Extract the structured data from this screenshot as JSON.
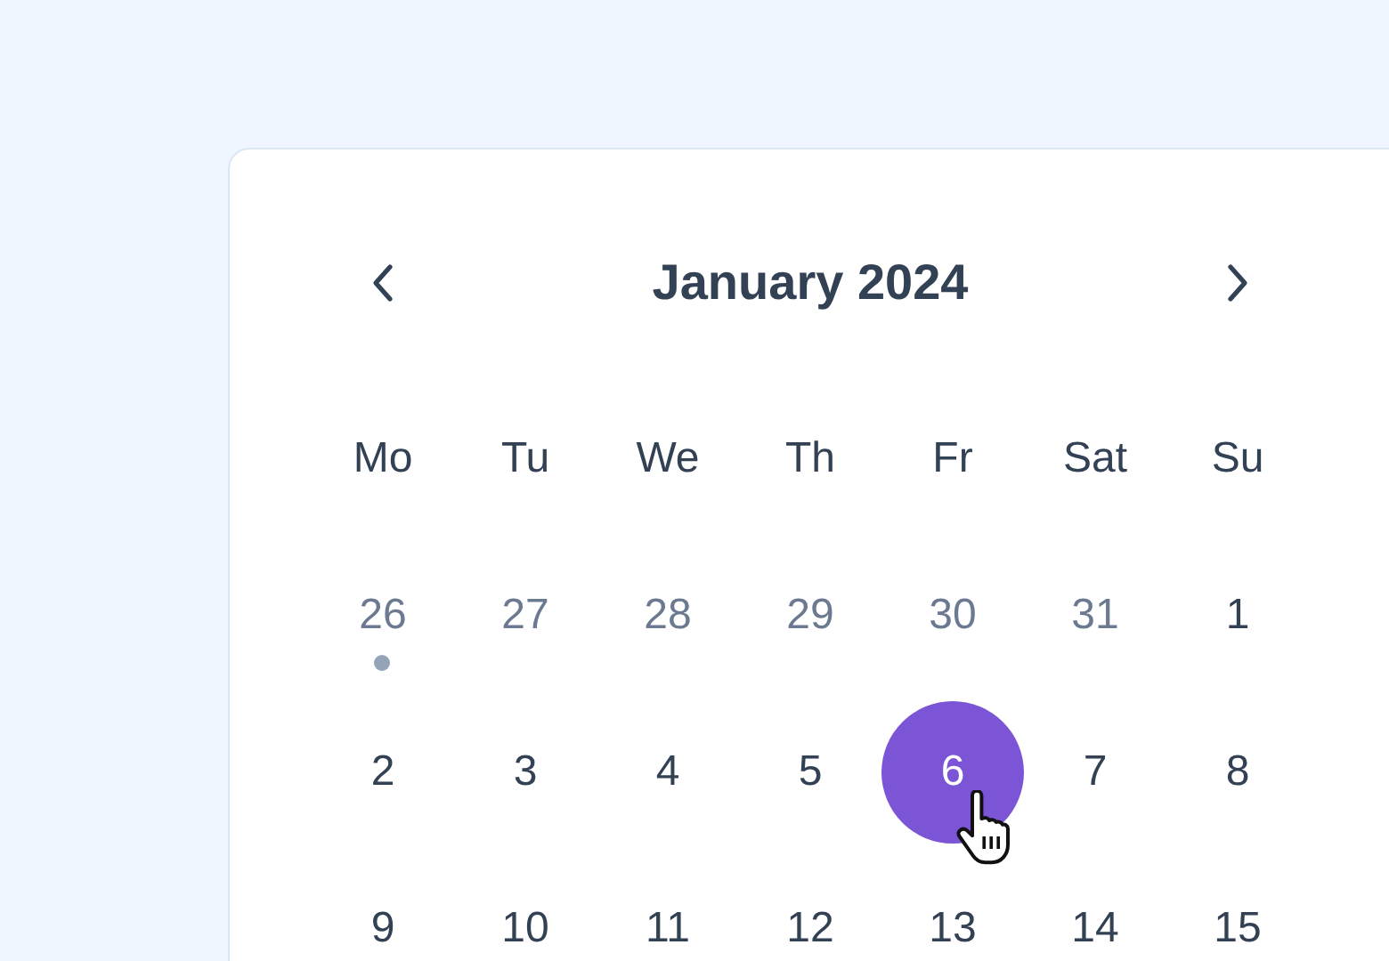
{
  "calendar": {
    "title": "January 2024",
    "weekdays": [
      "Mo",
      "Tu",
      "We",
      "Th",
      "Fr",
      "Sat",
      "Su"
    ],
    "weeks": [
      [
        {
          "label": "26",
          "outside_month": true,
          "selected": false,
          "has_event": true
        },
        {
          "label": "27",
          "outside_month": true,
          "selected": false,
          "has_event": false
        },
        {
          "label": "28",
          "outside_month": true,
          "selected": false,
          "has_event": false
        },
        {
          "label": "29",
          "outside_month": true,
          "selected": false,
          "has_event": false
        },
        {
          "label": "30",
          "outside_month": true,
          "selected": false,
          "has_event": false
        },
        {
          "label": "31",
          "outside_month": true,
          "selected": false,
          "has_event": false
        },
        {
          "label": "1",
          "outside_month": false,
          "selected": false,
          "has_event": false
        }
      ],
      [
        {
          "label": "2",
          "outside_month": false,
          "selected": false,
          "has_event": false
        },
        {
          "label": "3",
          "outside_month": false,
          "selected": false,
          "has_event": false
        },
        {
          "label": "4",
          "outside_month": false,
          "selected": false,
          "has_event": false
        },
        {
          "label": "5",
          "outside_month": false,
          "selected": false,
          "has_event": false
        },
        {
          "label": "6",
          "outside_month": false,
          "selected": true,
          "has_event": false
        },
        {
          "label": "7",
          "outside_month": false,
          "selected": false,
          "has_event": false
        },
        {
          "label": "8",
          "outside_month": false,
          "selected": false,
          "has_event": false
        }
      ],
      [
        {
          "label": "9",
          "outside_month": false,
          "selected": false,
          "has_event": false
        },
        {
          "label": "10",
          "outside_month": false,
          "selected": false,
          "has_event": false
        },
        {
          "label": "11",
          "outside_month": false,
          "selected": false,
          "has_event": false
        },
        {
          "label": "12",
          "outside_month": false,
          "selected": false,
          "has_event": false
        },
        {
          "label": "13",
          "outside_month": false,
          "selected": false,
          "has_event": false
        },
        {
          "label": "14",
          "outside_month": false,
          "selected": false,
          "has_event": false
        },
        {
          "label": "15",
          "outside_month": false,
          "selected": false,
          "has_event": false
        }
      ]
    ]
  }
}
